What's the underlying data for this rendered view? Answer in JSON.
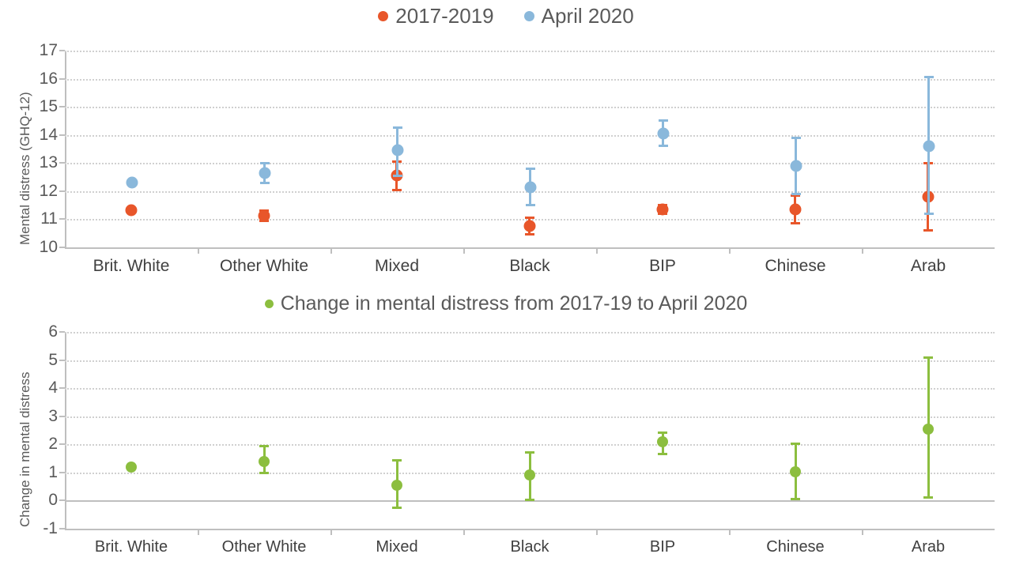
{
  "chart_data": [
    {
      "id": "top",
      "type": "scatter",
      "title": "",
      "xlabel": "",
      "ylabel": "Mental distress (GHQ-12)",
      "ylim": [
        10,
        17
      ],
      "yticks": [
        10,
        11,
        12,
        13,
        14,
        15,
        16,
        17
      ],
      "grid": true,
      "legend_position": "top-center",
      "categories": [
        "Brit. White",
        "Other White",
        "Mixed",
        "Black",
        "BIP",
        "Chinese",
        "Arab"
      ],
      "series": [
        {
          "name": "2017-2019",
          "color": "#E8562A",
          "values": [
            11.32,
            11.13,
            12.55,
            10.75,
            11.35,
            11.35,
            11.8
          ],
          "ci_low": [
            11.32,
            10.95,
            12.05,
            10.45,
            11.2,
            10.85,
            10.6
          ],
          "ci_high": [
            11.32,
            11.32,
            13.05,
            11.05,
            11.5,
            11.85,
            13.0
          ]
        },
        {
          "name": "April 2020",
          "color": "#8AB8DB",
          "values": [
            12.31,
            12.63,
            13.45,
            12.15,
            14.05,
            12.9,
            13.6
          ],
          "ci_low": [
            12.31,
            12.28,
            12.55,
            11.5,
            13.6,
            11.9,
            11.2
          ],
          "ci_high": [
            12.31,
            13.0,
            14.25,
            12.8,
            14.5,
            13.9,
            16.05
          ]
        }
      ]
    },
    {
      "id": "bottom",
      "type": "scatter",
      "title": "Change in mental distress from 2017-19 to April 2020",
      "xlabel": "",
      "ylabel": "Change in mental distress",
      "ylim": [
        -1,
        6
      ],
      "yticks": [
        -1,
        0,
        1,
        2,
        3,
        4,
        5,
        6
      ],
      "grid": true,
      "legend_position": "top-center",
      "categories": [
        "Brit. White",
        "Other White",
        "Mixed",
        "Black",
        "BIP",
        "Chinese",
        "Arab"
      ],
      "series": [
        {
          "name": "Change in mental distress from 2017-19 to April 2020",
          "color": "#8CBE3F",
          "values": [
            1.18,
            1.38,
            0.55,
            0.9,
            2.1,
            1.02,
            2.55
          ],
          "ci_low": [
            1.18,
            0.98,
            -0.25,
            0.03,
            1.65,
            0.05,
            0.1
          ],
          "ci_high": [
            1.18,
            1.95,
            1.43,
            1.72,
            2.42,
            2.02,
            5.1
          ]
        }
      ]
    }
  ],
  "legend_top": {
    "items": [
      {
        "label": "2017-2019",
        "color": "#E8562A"
      },
      {
        "label": "April 2020",
        "color": "#8AB8DB"
      }
    ]
  },
  "legend_bottom": {
    "items": [
      {
        "label": "Change in mental distress from 2017-19 to April 2020",
        "color": "#8CBE3F"
      }
    ]
  }
}
